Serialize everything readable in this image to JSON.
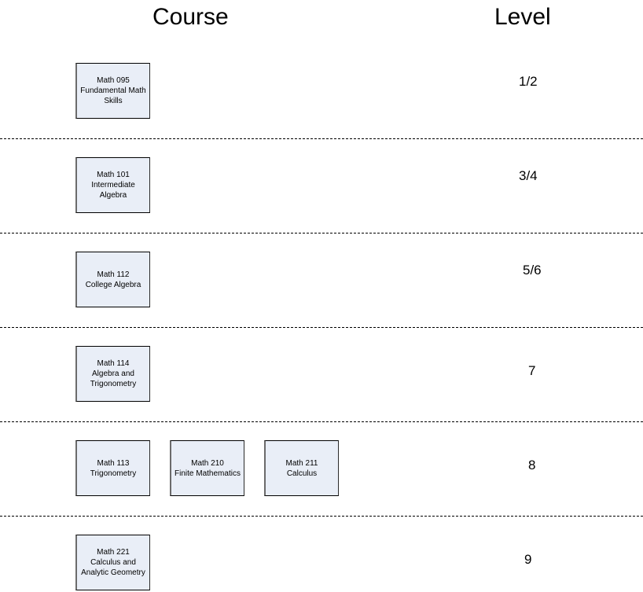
{
  "headers": {
    "course": "Course",
    "level": "Level"
  },
  "rows": [
    {
      "level": "1/2",
      "courses": [
        {
          "code": "Math 095",
          "title": "Fundamental Math\nSkills"
        }
      ]
    },
    {
      "level": "3/4",
      "courses": [
        {
          "code": "Math 101",
          "title": "Intermediate\nAlgebra"
        }
      ]
    },
    {
      "level": "5/6",
      "courses": [
        {
          "code": "Math 112",
          "title": "College Algebra"
        }
      ]
    },
    {
      "level": "7",
      "courses": [
        {
          "code": "Math 114",
          "title": "Algebra and\nTrigonometry"
        }
      ]
    },
    {
      "level": "8",
      "courses": [
        {
          "code": "Math 113",
          "title": "Trigonometry"
        },
        {
          "code": "Math 210",
          "title": "Finite Mathematics"
        },
        {
          "code": "Math 211",
          "title": "Calculus"
        }
      ]
    },
    {
      "level": "9",
      "courses": [
        {
          "code": "Math 221",
          "title": "Calculus and\nAnalytic Geometry"
        }
      ]
    }
  ],
  "colors": {
    "box_fill": "#e9eef7",
    "divider": "#000000"
  }
}
